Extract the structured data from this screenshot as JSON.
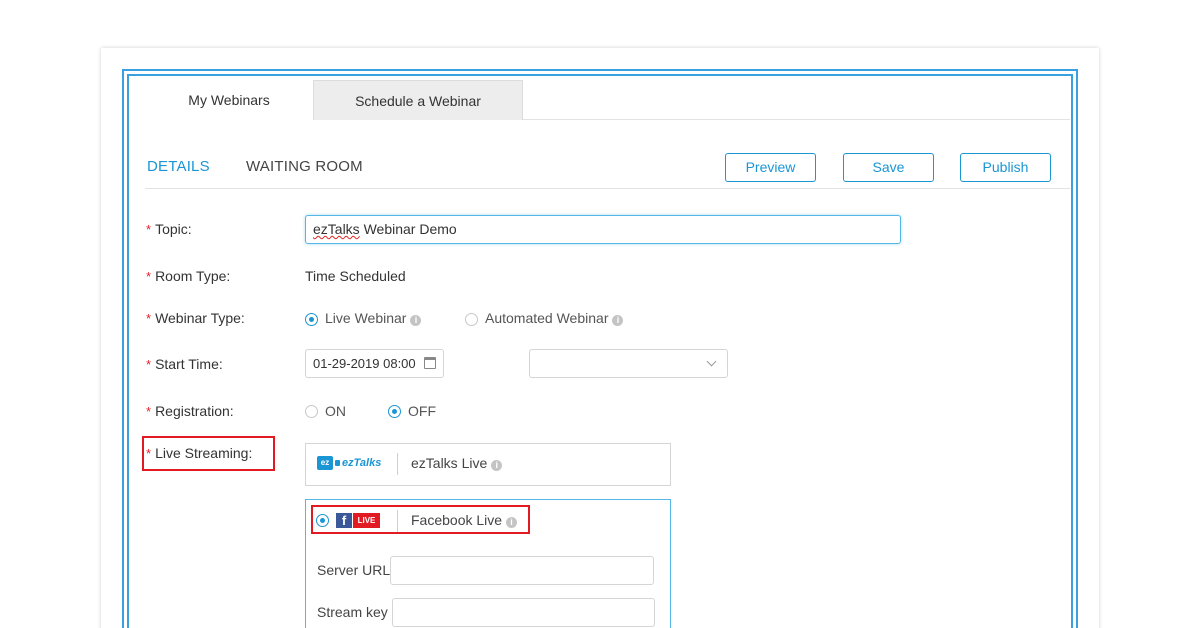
{
  "tabs": {
    "my_webinars": "My Webinars",
    "schedule": "Schedule a Webinar"
  },
  "subtabs": {
    "details": "DETAILS",
    "waiting_room": "WAITING ROOM"
  },
  "buttons": {
    "preview": "Preview",
    "save": "Save",
    "publish": "Publish"
  },
  "form": {
    "required_mark": "*",
    "topic_label": "Topic:",
    "topic_value_word": "ezTalks",
    "topic_value_rest": " Webinar Demo",
    "room_type_label": "Room Type:",
    "room_type_value": "Time Scheduled",
    "webinar_type_label": "Webinar Type:",
    "webinar_type_options": [
      "Live Webinar",
      "Automated Webinar"
    ],
    "webinar_type_selected": "Live Webinar",
    "start_time_label": "Start Time:",
    "start_time_value": "01-29-2019 08:00",
    "registration_label": "Registration:",
    "registration_options": [
      "ON",
      "OFF"
    ],
    "registration_selected": "OFF",
    "live_streaming_label": "Live Streaming:"
  },
  "streaming": {
    "ez_logo_badge": "ez",
    "ez_logo_text": "ezTalks",
    "ez_name": "ezTalks Live",
    "fb_glyph": "f",
    "live_badge": "LIVE",
    "fb_name": "Facebook Live",
    "server_url_label": "Server URL",
    "stream_key_label": "Stream key"
  },
  "icons": {
    "info_glyph": "i"
  },
  "colors": {
    "accent": "#1a96d4",
    "frame_border": "#3aa0e0",
    "highlight_red": "#e21b23",
    "required_red": "#e02424",
    "facebook_blue": "#3b5998"
  }
}
